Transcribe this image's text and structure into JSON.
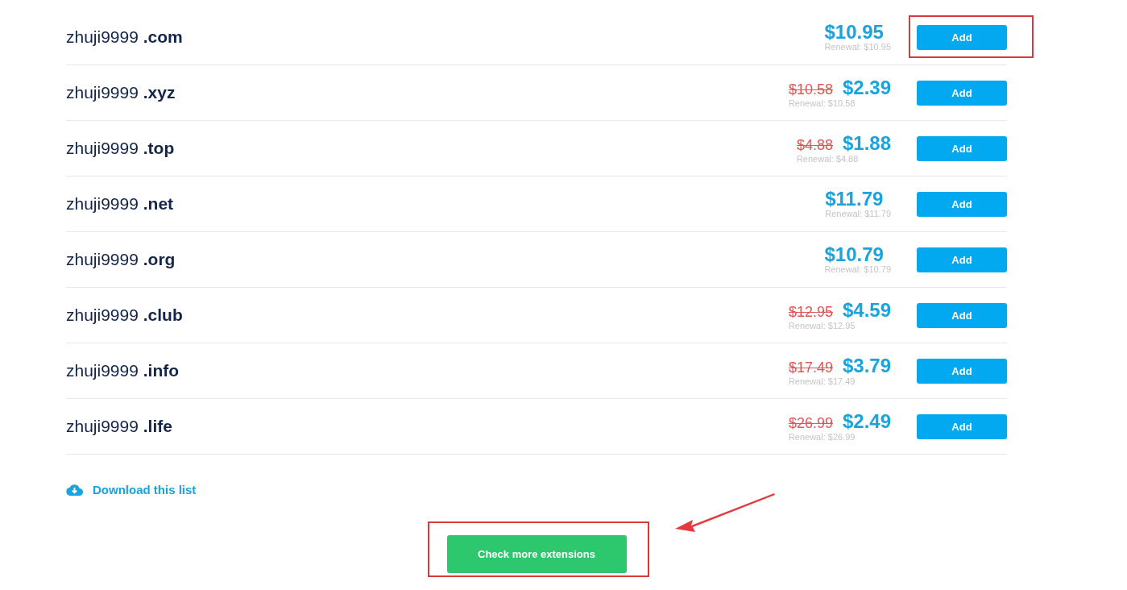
{
  "domains": [
    {
      "name": "zhuji9999",
      "tld": ".com",
      "price": "$10.95",
      "renewal": "Renewal: $10.95",
      "button": "Add",
      "highlighted": true
    },
    {
      "name": "zhuji9999",
      "tld": ".xyz",
      "old_price": "$10.58",
      "price": "$2.39",
      "renewal": "Renewal: $10.58",
      "button": "Add",
      "highlighted": false
    },
    {
      "name": "zhuji9999",
      "tld": ".top",
      "old_price": "$4.88",
      "price": "$1.88",
      "renewal": "Renewal: $4.88",
      "button": "Add",
      "highlighted": false
    },
    {
      "name": "zhuji9999",
      "tld": ".net",
      "price": "$11.79",
      "renewal": "Renewal: $11.79",
      "button": "Add",
      "highlighted": false
    },
    {
      "name": "zhuji9999",
      "tld": ".org",
      "price": "$10.79",
      "renewal": "Renewal: $10.79",
      "button": "Add",
      "highlighted": false
    },
    {
      "name": "zhuji9999",
      "tld": ".club",
      "old_price": "$12.95",
      "price": "$4.59",
      "renewal": "Renewal: $12.95",
      "button": "Add",
      "highlighted": false
    },
    {
      "name": "zhuji9999",
      "tld": ".info",
      "old_price": "$17.49",
      "price": "$3.79",
      "renewal": "Renewal: $17.49",
      "button": "Add",
      "highlighted": false
    },
    {
      "name": "zhuji9999",
      "tld": ".life",
      "old_price": "$26.99",
      "price": "$2.49",
      "renewal": "Renewal: $26.99",
      "button": "Add",
      "highlighted": false
    }
  ],
  "download_link": "Download this list",
  "more_button": {
    "label": "Check more extensions",
    "highlighted": true
  },
  "annotation_arrow": true
}
